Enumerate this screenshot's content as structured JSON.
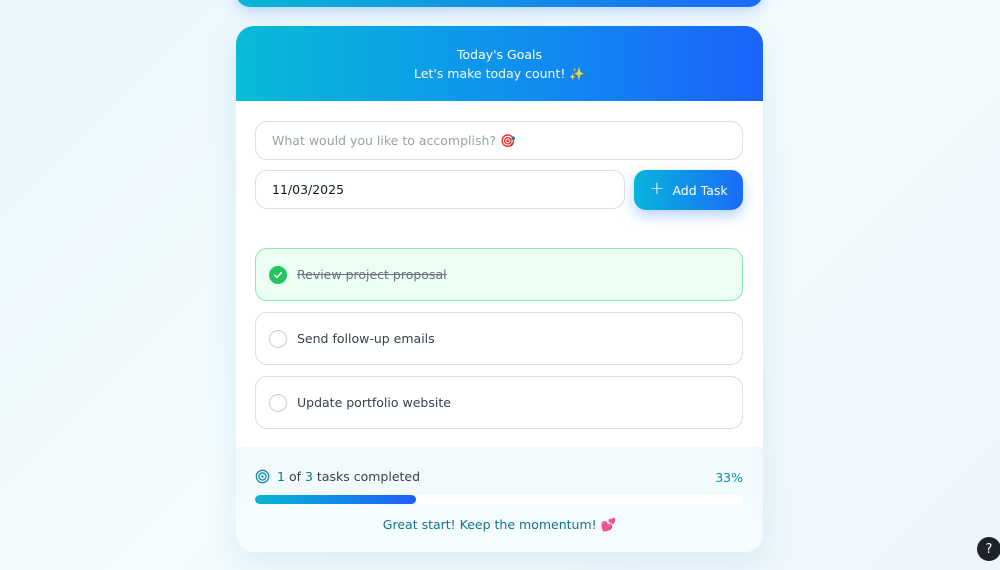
{
  "header": {
    "title": "Today's Goals",
    "subtitle": "Let's make today count! ✨"
  },
  "form": {
    "task_placeholder": "What would you like to accomplish? 🎯",
    "date_value": "11/03/2025",
    "add_button_label": "Add Task"
  },
  "tasks": [
    {
      "label": "Review project proposal",
      "completed": true
    },
    {
      "label": "Send follow-up emails",
      "completed": false
    },
    {
      "label": "Update portfolio website",
      "completed": false
    }
  ],
  "progress": {
    "completed": "1",
    "of_text": "of",
    "total": "3",
    "suffix": "tasks completed",
    "percent_label": "33%",
    "percent_value": 33,
    "message": "Great start! Keep the momentum! 💕"
  },
  "help": {
    "label": "?"
  },
  "colors": {
    "accent_start": "#06b6d4",
    "accent_end": "#1d6af8",
    "done_bg": "#ecfdf3",
    "done_border": "#86efac",
    "check_green": "#22c55e"
  }
}
